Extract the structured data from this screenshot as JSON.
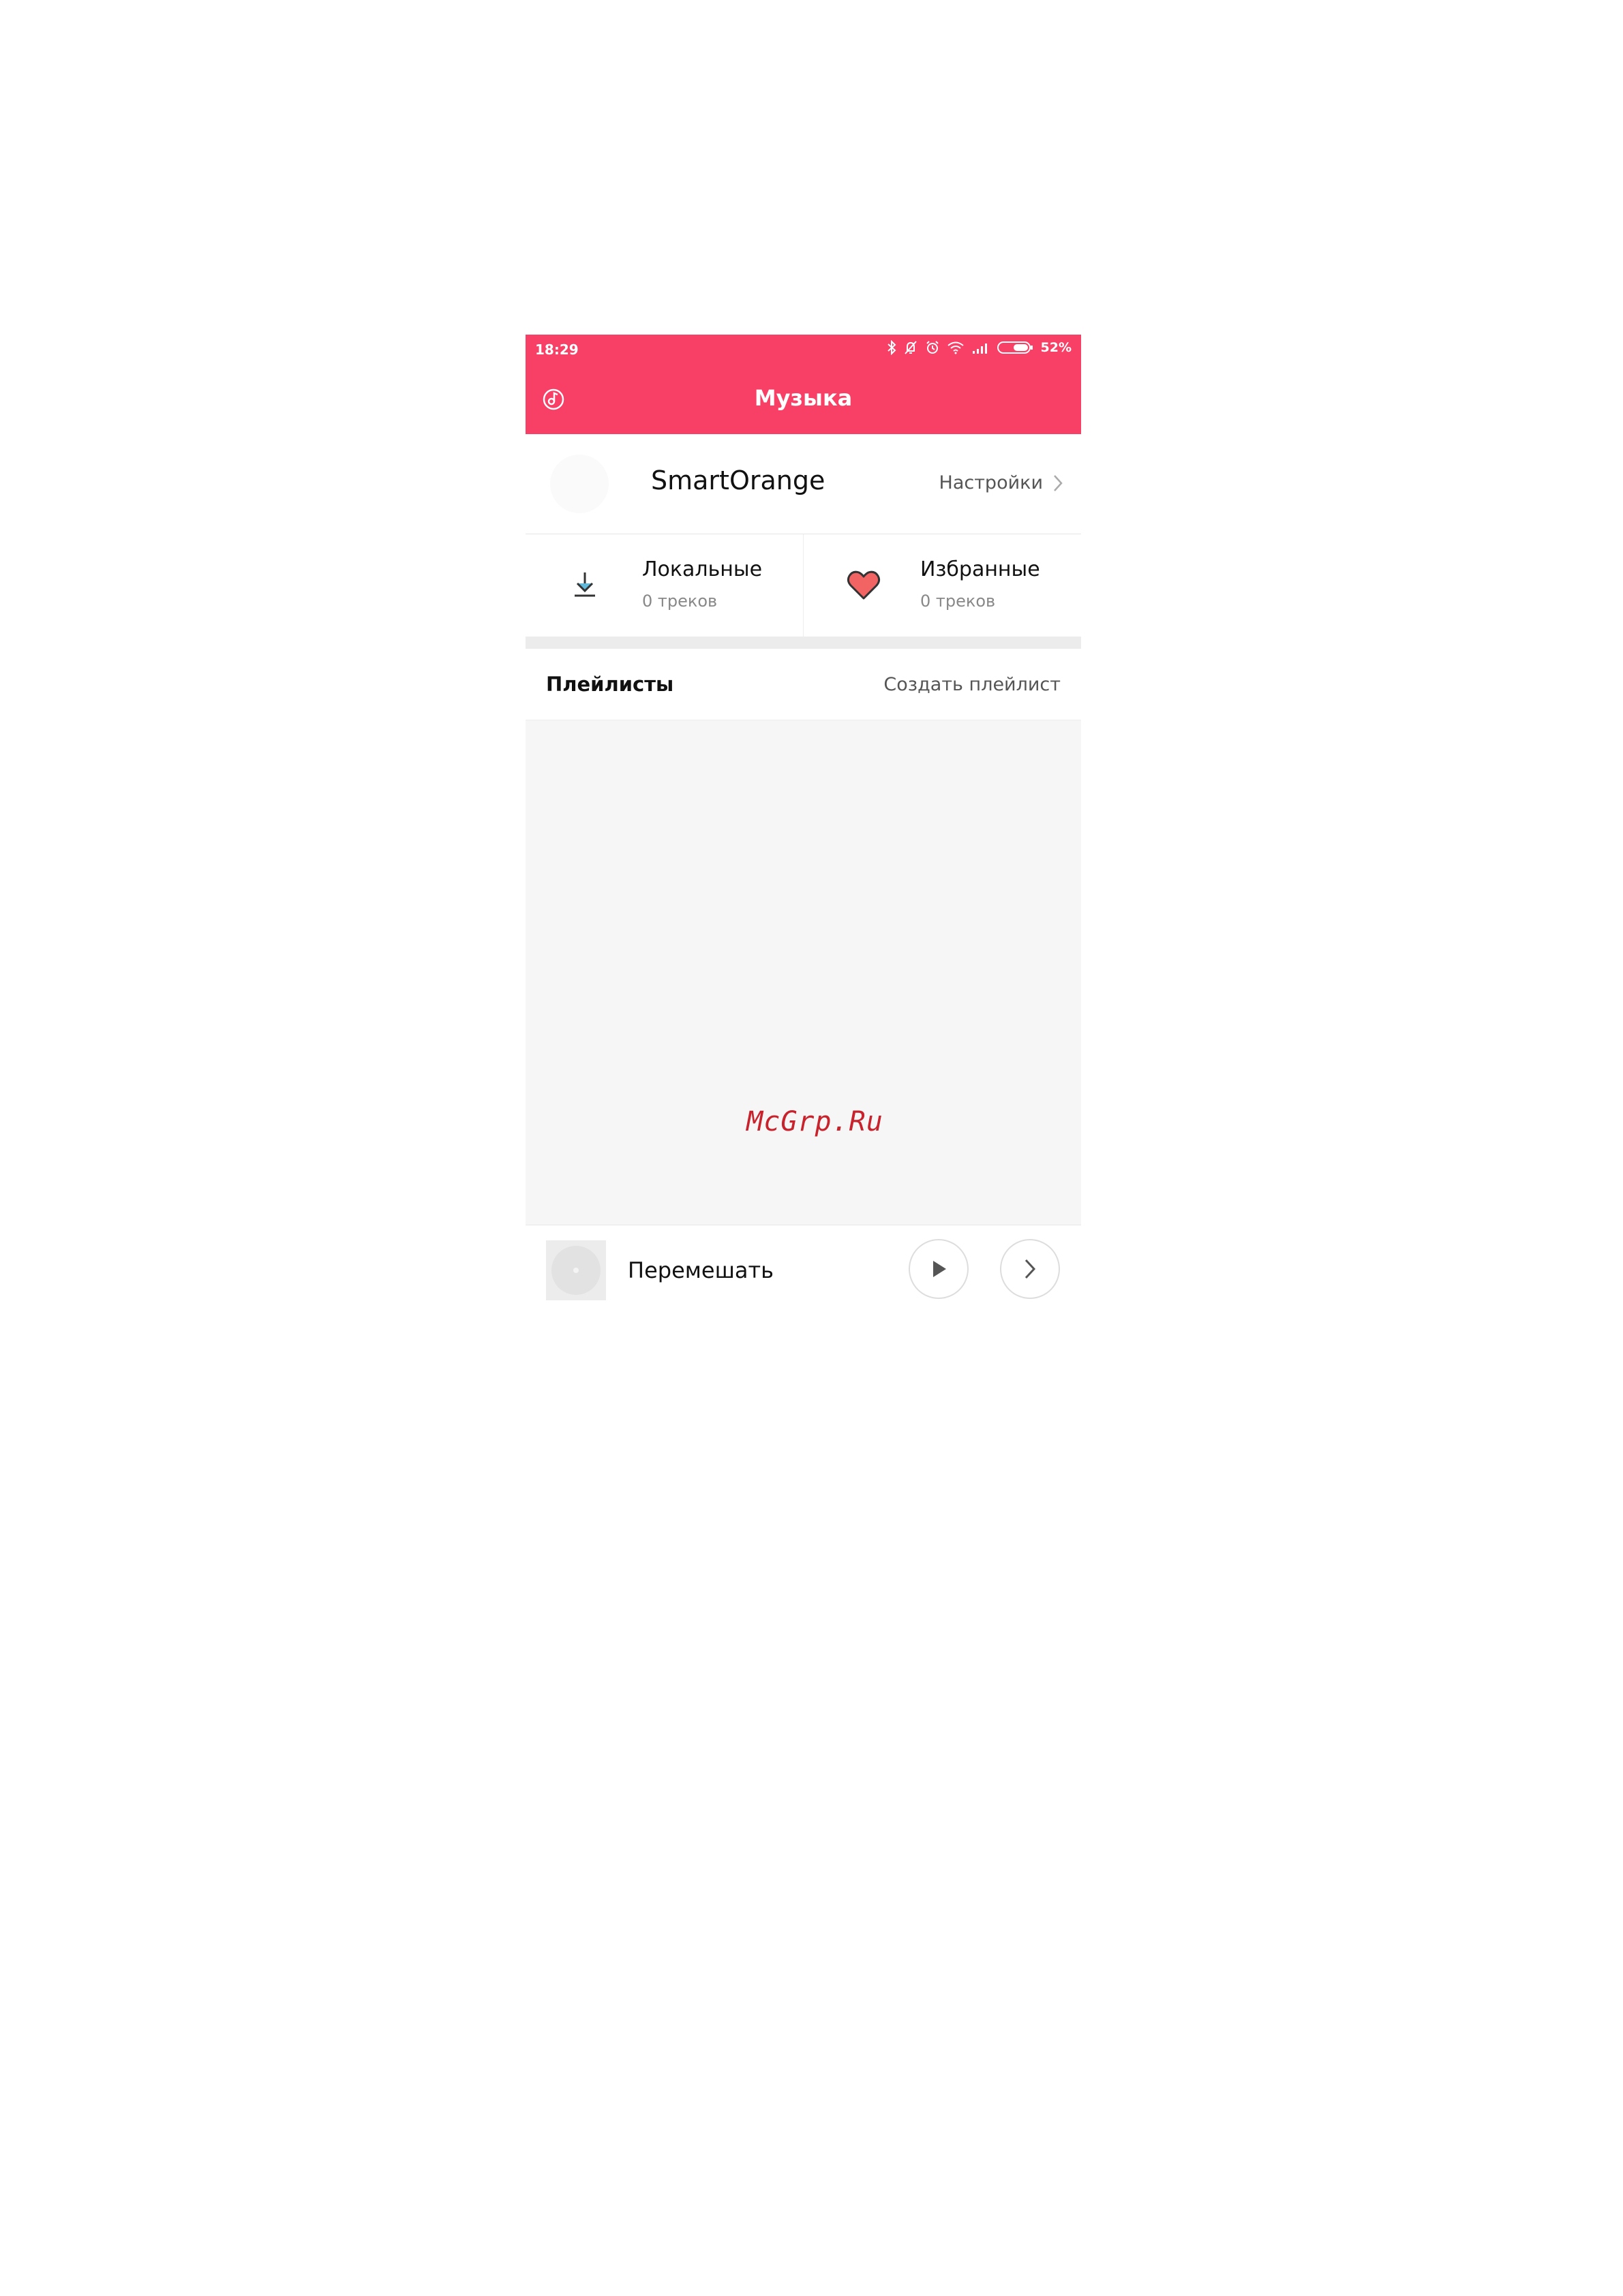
{
  "status_bar": {
    "time": "18:29",
    "battery_percent": "52%",
    "icons": [
      "bluetooth-icon",
      "notifications-off-icon",
      "alarm-icon",
      "wifi-icon",
      "signal-icon",
      "battery-icon"
    ]
  },
  "app_bar": {
    "title": "Музыка",
    "left_icon": "music-note-icon"
  },
  "profile": {
    "username": "SmartOrange",
    "settings_label": "Настройки"
  },
  "categories": [
    {
      "title": "Локальные",
      "count": "0 треков",
      "icon": "download-icon"
    },
    {
      "title": "Избранные",
      "count": "0 треков",
      "icon": "heart-icon"
    }
  ],
  "playlists": {
    "title": "Плейлисты",
    "create_label": "Создать плейлист"
  },
  "watermark": "McGrp.Ru",
  "player": {
    "track_label": "Перемешать",
    "play_icon": "play-icon",
    "next_icon": "chevron-right-icon"
  },
  "colors": {
    "accent": "#f83f66",
    "heart": "#f26464",
    "watermark": "#c8222c",
    "background_empty": "#f6f6f6"
  }
}
